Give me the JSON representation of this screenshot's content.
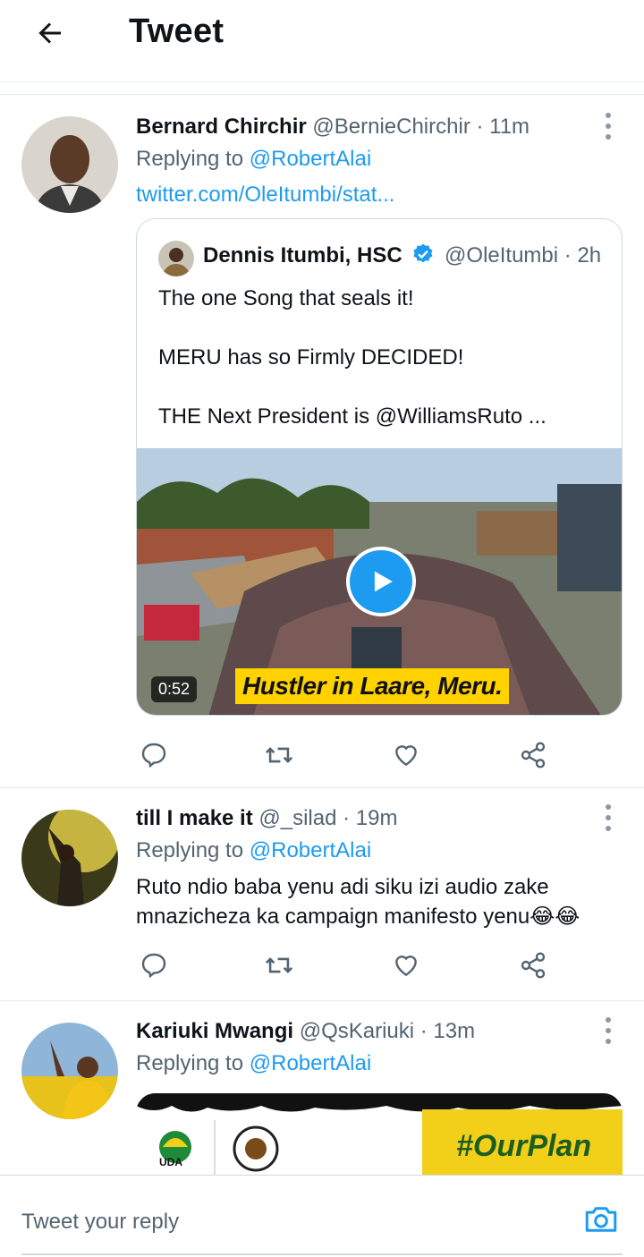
{
  "header": {
    "title": "Tweet",
    "back_icon": "arrow-left-icon"
  },
  "tweets": [
    {
      "author_name": "Bernard Chirchir",
      "handle": "@BernieChirchir",
      "time": "· 11m",
      "replying_prefix": "Replying to ",
      "replying_to": "@RobertAlai",
      "link": "twitter.com/OleItumbi/stat...",
      "quote": {
        "author_name": "Dennis Itumbi, HSC",
        "handle": "@OleItumbi",
        "time": "· 2h",
        "lines": [
          "The one Song that seals it!",
          "MERU has so Firmly  DECIDED!",
          "THE Next President is @WilliamsRuto ..."
        ],
        "video_duration": "0:52",
        "video_caption": "Hustler in Laare, Meru."
      }
    },
    {
      "author_name": "till I make it",
      "handle": "@_silad",
      "time": "· 19m",
      "replying_prefix": "Replying to ",
      "replying_to": "@RobertAlai",
      "text": "Ruto ndio baba yenu adi siku izi audio zake mnazicheza ka campaign manifesto yenu😂😂"
    },
    {
      "author_name": "Kariuki Mwangi",
      "handle": "@QsKariuki",
      "time": "· 13m",
      "replying_prefix": "Replying to ",
      "replying_to": "@RobertAlai",
      "media_logo_text": "UDA",
      "media_banner": "#OurPlan"
    }
  ],
  "reply_bar": {
    "placeholder": "Tweet your reply",
    "icon": "camera-icon"
  },
  "colors": {
    "accent": "#1d9bf0",
    "muted": "#536471",
    "border": "#e6ecf0"
  }
}
